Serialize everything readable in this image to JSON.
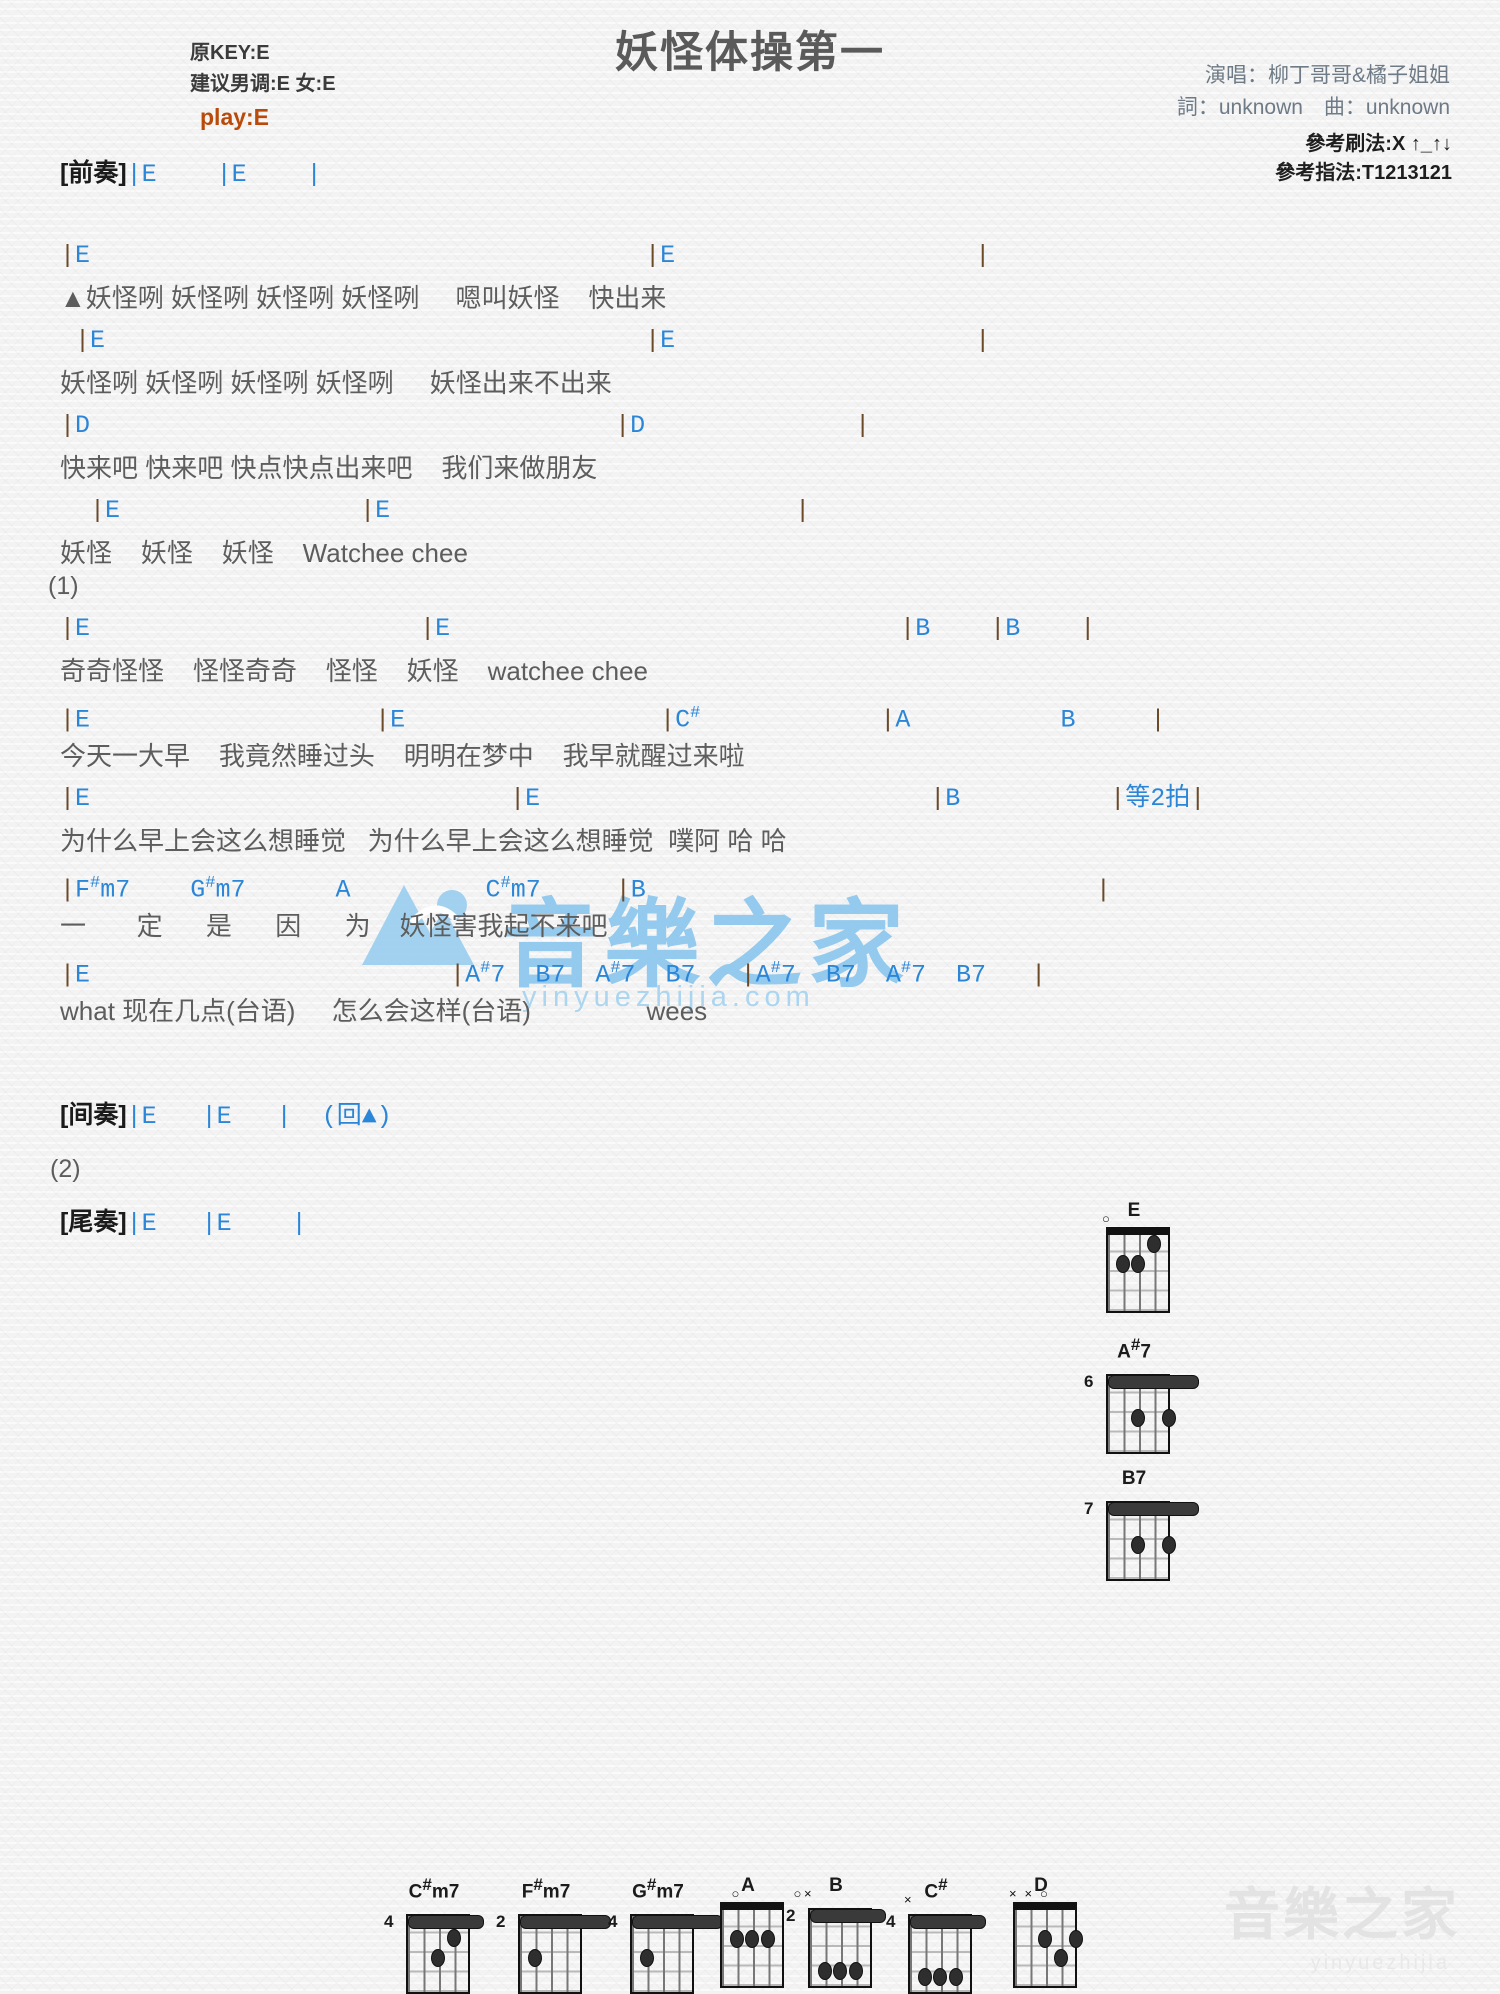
{
  "header": {
    "title": "妖怪体操第一",
    "orig_key": "原KEY:E",
    "suggested": "建议男调:E 女:E",
    "play": "play:E",
    "singer": "演唱：柳丁哥哥&橘子姐姐",
    "writer": "詞：unknown　曲：unknown",
    "strum": "參考刷法:X ↑_↑↓",
    "finger": "參考指法:T1213121"
  },
  "watermark": {
    "text": "音樂之家",
    "sub": "yinyuezhijia.com",
    "corner": "音樂之家",
    "corner_sub": "yinyuezhijia"
  },
  "sections": {
    "intro_tag": "[前奏]",
    "intro_chords": "|E    |E    |",
    "interlude_tag": "[间奏]",
    "interlude_chords": "|E   |E   |  (回▲)",
    "outro_tag": "[尾奏]",
    "outro_chords": "|E   |E    |",
    "verse1_num": "(1)",
    "verse2_num": "(2)"
  },
  "lines": [
    {
      "chords": "|E                                     |E                    |",
      "lyrics": "▲妖怪咧 妖怪咧 妖怪咧 妖怪咧     嗯叫妖怪    快出来"
    },
    {
      "chords": " |E                                    |E                    |",
      "lyrics": "妖怪咧 妖怪咧 妖怪咧 妖怪咧     妖怪出来不出来"
    },
    {
      "chords": "|D                                   |D              |",
      "lyrics": "快来吧 快来吧 快点快点出来吧    我们来做朋友"
    },
    {
      "chords": "  |E                |E                           |",
      "lyrics": "妖怪    妖怪    妖怪    Watchee chee"
    },
    {
      "chords": "|E                      |E                              |B    |B    |",
      "lyrics": "奇奇怪怪    怪怪奇奇    怪怪    妖怪    watchee chee"
    },
    {
      "chords": "|E                   |E                 |C#            |A          B     |",
      "lyrics": "今天一大早    我竟然睡过头    明明在梦中    我早就醒过来啦"
    },
    {
      "chords": "|E                            |E                          |B          |等2拍|",
      "lyrics": "为什么早上会这么想睡觉   为什么早上会这么想睡觉  噗阿 哈 哈"
    },
    {
      "chords": "|F#m7    G#m7      A         C#m7     |B                              |",
      "lyrics": "一       定      是      因      为    妖怪害我起不来吧"
    },
    {
      "chords": "|E                        |A#7  B7  A#7  B7   |A#7  B7  A#7  B7   |",
      "lyrics": "what 现在几点(台语)     怎么会这样(台语)                wees"
    }
  ],
  "chord_diagrams_bottom": [
    {
      "name": "C#m7",
      "fret": "4",
      "barre": true,
      "barre_start": 0,
      "barre_span": 5,
      "dots": [
        {
          "s": 2,
          "f": 2
        },
        {
          "s": 3,
          "f": 1
        }
      ],
      "open": [],
      "mute": []
    },
    {
      "name": "F#m7",
      "fret": "2",
      "barre": true,
      "barre_start": 0,
      "barre_span": 6,
      "dots": [
        {
          "s": 1,
          "f": 2
        }
      ],
      "open": [],
      "mute": []
    },
    {
      "name": "G#m7",
      "fret": "4",
      "barre": true,
      "barre_start": 0,
      "barre_span": 6,
      "dots": [
        {
          "s": 1,
          "f": 2
        }
      ],
      "open": [],
      "mute": []
    },
    {
      "name": "A",
      "fret": "",
      "barre": false,
      "barre_start": 0,
      "barre_span": 0,
      "dots": [
        {
          "s": 1,
          "f": 2
        },
        {
          "s": 2,
          "f": 2
        },
        {
          "s": 3,
          "f": 2
        }
      ],
      "open": [
        1,
        5
      ],
      "mute": []
    },
    {
      "name": "B",
      "fret": "2",
      "barre": true,
      "barre_start": 0,
      "barre_span": 5,
      "dots": [
        {
          "s": 1,
          "f": 3
        },
        {
          "s": 2,
          "f": 3
        },
        {
          "s": 3,
          "f": 3
        }
      ],
      "open": [],
      "mute": [
        0
      ]
    },
    {
      "name": "C#",
      "fret": "4",
      "barre": true,
      "barre_start": 0,
      "barre_span": 5,
      "dots": [
        {
          "s": 1,
          "f": 3
        },
        {
          "s": 2,
          "f": 3
        },
        {
          "s": 3,
          "f": 3
        }
      ],
      "open": [],
      "mute": [
        0
      ]
    },
    {
      "name": "D",
      "fret": "",
      "barre": false,
      "barre_start": 0,
      "barre_span": 0,
      "dots": [
        {
          "s": 2,
          "f": 2
        },
        {
          "s": 3,
          "f": 3
        },
        {
          "s": 4,
          "f": 2
        }
      ],
      "open": [
        2
      ],
      "mute": [
        0,
        1
      ]
    }
  ],
  "chord_diagrams_right": [
    {
      "name": "E",
      "fret": "",
      "barre": false,
      "barre_start": 0,
      "barre_span": 0,
      "dots": [
        {
          "s": 1,
          "f": 2
        },
        {
          "s": 2,
          "f": 2
        },
        {
          "s": 3,
          "f": 1
        }
      ],
      "open": [
        0
      ],
      "mute": []
    },
    {
      "name": "A#7",
      "fret": "6",
      "barre": true,
      "barre_start": 0,
      "barre_span": 6,
      "dots": [
        {
          "s": 2,
          "f": 2
        },
        {
          "s": 4,
          "f": 2
        }
      ],
      "open": [],
      "mute": []
    },
    {
      "name": "B7",
      "fret": "7",
      "barre": true,
      "barre_start": 0,
      "barre_span": 6,
      "dots": [
        {
          "s": 2,
          "f": 2
        },
        {
          "s": 4,
          "f": 2
        }
      ],
      "open": [],
      "mute": []
    }
  ]
}
